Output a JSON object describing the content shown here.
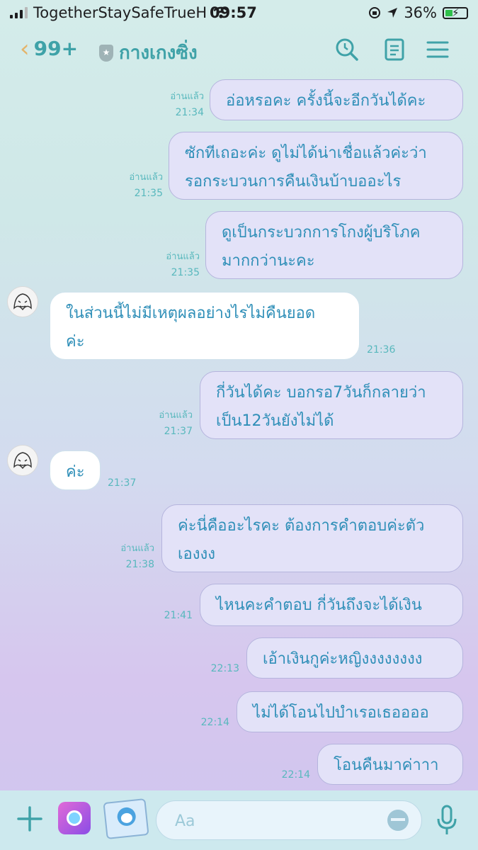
{
  "status_bar": {
    "carrier": "TogetherStaySafeTrueH",
    "time": "09:57",
    "battery": "36%",
    "battery_level": 0.36
  },
  "header": {
    "back_count": "99+",
    "chat_title": "กางเกงซิ่ง",
    "icons": [
      "chevron-left-icon",
      "shield-icon",
      "search-icon",
      "notes-icon",
      "menu-icon"
    ]
  },
  "messages": [
    {
      "dir": "out",
      "text": "อ่อหรอคะ ครั้งนี้จะอีกวันได้คะ",
      "read": "อ่านแล้ว",
      "time": "21:34"
    },
    {
      "dir": "out",
      "text": "ซักทีเถอะค่ะ ดูไม่ได้น่าเชื่อแล้วค่ะว่า\nรอกระบวนการคืนเงินบ้าบออะไร",
      "read": "อ่านแล้ว",
      "time": "21:35"
    },
    {
      "dir": "out",
      "text": "ดูเป็นกระบวกการโกงผู้บริโภค\nมากกว่านะคะ",
      "read": "อ่านแล้ว",
      "time": "21:35"
    },
    {
      "dir": "in",
      "text": "ในส่วนนี้ไม่มีเหตุผลอย่างไรไม่คืนยอด\nค่ะ",
      "time": "21:36"
    },
    {
      "dir": "out",
      "text": "กี่วันได้คะ บอกรอ7วันก็กลายว่า\nเป็น12วันยังไม่ได้",
      "read": "อ่านแล้ว",
      "time": "21:37"
    },
    {
      "dir": "in",
      "text": "ค่ะ",
      "time": "21:37"
    },
    {
      "dir": "out",
      "text": "ค่ะนี่คืออะไรคะ ต้องการคำตอบค่ะตัว\nเองงง",
      "read": "อ่านแล้ว",
      "time": "21:38"
    },
    {
      "dir": "out",
      "text": "ไหนคะคำตอบ กี่วันถึงจะได้เงิน",
      "time": "21:41"
    },
    {
      "dir": "out",
      "text": "เอ้าเงินกูค่ะหญิงงงงงงงง",
      "time": "22:13"
    },
    {
      "dir": "out",
      "text": "ไม่ได้โอนไปบำเรอเธออออ",
      "time": "22:14"
    },
    {
      "dir": "out",
      "text": "โอนคืนมาค่าาา",
      "time": "22:14"
    }
  ],
  "input_bar": {
    "placeholder": "Aa",
    "icons": [
      "plus-icon",
      "camera-icon",
      "sticker-icon",
      "emoji-icon",
      "microphone-icon"
    ]
  }
}
